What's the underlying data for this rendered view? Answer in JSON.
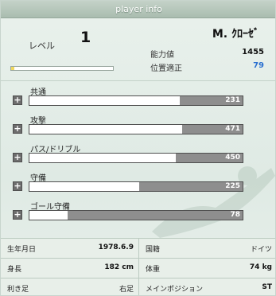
{
  "window": {
    "title": "player info"
  },
  "player": {
    "level_label": "レベル",
    "level": "1",
    "level_progress": 0.03,
    "name": "M. ｸﾛｰｾﾞ",
    "ability_label": "能力値",
    "ability_value": "1455",
    "position_fit_label": "位置適正",
    "position_fit_value": "79"
  },
  "abilities": [
    {
      "name": "共通",
      "value": 231,
      "fill": 0.705
    },
    {
      "name": "攻撃",
      "value": 471,
      "fill": 0.715
    },
    {
      "name": "パス/ドリブル",
      "value": 450,
      "fill": 0.685
    },
    {
      "name": "守備",
      "value": 225,
      "fill": 0.515
    },
    {
      "name": "ゴール守備",
      "value": 78,
      "fill": 0.18
    }
  ],
  "info": {
    "birthdate_label": "生年月日",
    "birthdate": "1978.6.9",
    "nationality_label": "国籍",
    "nationality": "ドイツ",
    "height_label": "身長",
    "height": "182 cm",
    "weight_label": "体重",
    "weight": "74 kg",
    "foot_label": "利き足",
    "foot": "右足",
    "position_label": "メインポジション",
    "position": "ST"
  },
  "colors": {
    "accent_blue": "#2a6fd0",
    "bar_track": "#8e8e8e",
    "level_fill": "#f0d860"
  }
}
